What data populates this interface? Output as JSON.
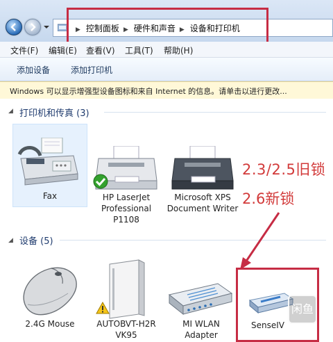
{
  "address_bar": {
    "crumbs": [
      "控制面板",
      "硬件和声音",
      "设备和打印机"
    ]
  },
  "menu": {
    "file": "文件(F)",
    "edit": "编辑(E)",
    "view": "查看(V)",
    "tools": "工具(T)",
    "help": "帮助(H)"
  },
  "toolbar": {
    "add_device": "添加设备",
    "add_printer": "添加打印机"
  },
  "infobar": {
    "text": "Windows 可以显示增强型设备图标和来自 Internet 的信息。请单击以进行更改..."
  },
  "groups": {
    "printers": {
      "title": "打印机和传真",
      "count": "(3)",
      "items": [
        {
          "label": "Fax"
        },
        {
          "label": "HP LaserJet Professional P1108"
        },
        {
          "label": "Microsoft XPS Document Writer"
        }
      ]
    },
    "devices": {
      "title": "设备",
      "count": "(5)",
      "items": [
        {
          "label": "2.4G Mouse"
        },
        {
          "label": "AUTOBVT-H2R VK95"
        },
        {
          "label": "MI WLAN Adapter"
        },
        {
          "label": "SenseIV"
        }
      ]
    }
  },
  "annotations": {
    "line1": "2.3/2.5旧锁",
    "line2": "2.6新锁",
    "color": "#d23a3a"
  },
  "watermark": {
    "text": "闲鱼"
  }
}
